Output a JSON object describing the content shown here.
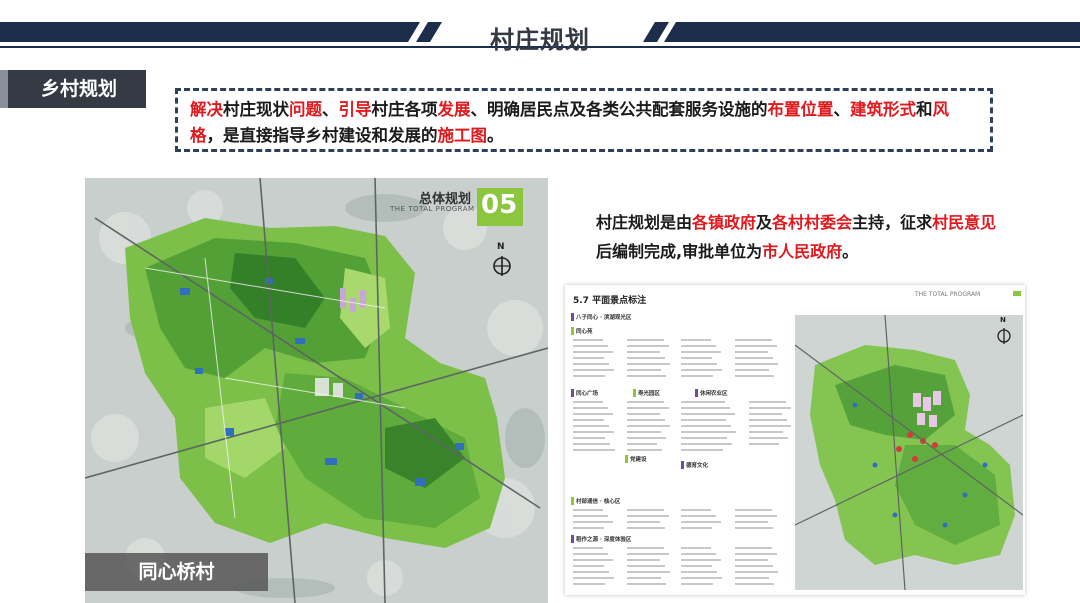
{
  "header": {
    "title": "村庄规划"
  },
  "section": {
    "label": "乡村规划"
  },
  "intro": [
    {
      "t": "解决",
      "red": true
    },
    {
      "t": "村庄现状",
      "red": false
    },
    {
      "t": "问题",
      "red": true
    },
    {
      "t": "、",
      "red": false
    },
    {
      "t": "引导",
      "red": true
    },
    {
      "t": "村庄各项",
      "red": false
    },
    {
      "t": "发展",
      "red": true
    },
    {
      "t": "、明确居民点及各类公共配套服务设施的",
      "red": false
    },
    {
      "t": "布置位置",
      "red": true
    },
    {
      "t": "、",
      "red": false
    },
    {
      "t": "建筑形式",
      "red": true
    },
    {
      "t": "和",
      "red": false
    },
    {
      "t": "风格",
      "red": true
    },
    {
      "t": "，是直接指导乡村建设和发展的",
      "red": false
    },
    {
      "t": "施工图",
      "red": true
    },
    {
      "t": "。",
      "red": false
    }
  ],
  "description": [
    {
      "t": "村庄规划是由",
      "red": false
    },
    {
      "t": "各镇政府",
      "red": true
    },
    {
      "t": "及",
      "red": false
    },
    {
      "t": "各村村委会",
      "red": true
    },
    {
      "t": "主持，征求",
      "red": false
    },
    {
      "t": "村民意见",
      "red": true
    },
    {
      "t": "后编制完成,审批单位为",
      "red": false
    },
    {
      "t": "市人民政府",
      "red": true
    },
    {
      "t": "。",
      "red": false
    }
  ],
  "map_left": {
    "title_cn": "总体规划",
    "title_en": "THE TOTAL PROGRAM",
    "number": "05",
    "north": "N"
  },
  "caption": "同心桥村",
  "plan": {
    "title": "5.7 平面景点标注",
    "header_en": "THE TOTAL PROGRAM",
    "north": "N",
    "group_heads": [
      "八子同心 · 滨湖观光区",
      "同心苑",
      "同心广场",
      "寿光园区",
      "休闲农业区",
      "党建设",
      "德育文化",
      "村部通信 · 核心区",
      "稻作之源 · 深度体验区"
    ]
  },
  "colors": {
    "navy": "#1d2e4d",
    "tab": "#353b44",
    "red": "#e0191e",
    "green_bright": "#8cc63f",
    "green_dark": "#3f8a2a"
  }
}
